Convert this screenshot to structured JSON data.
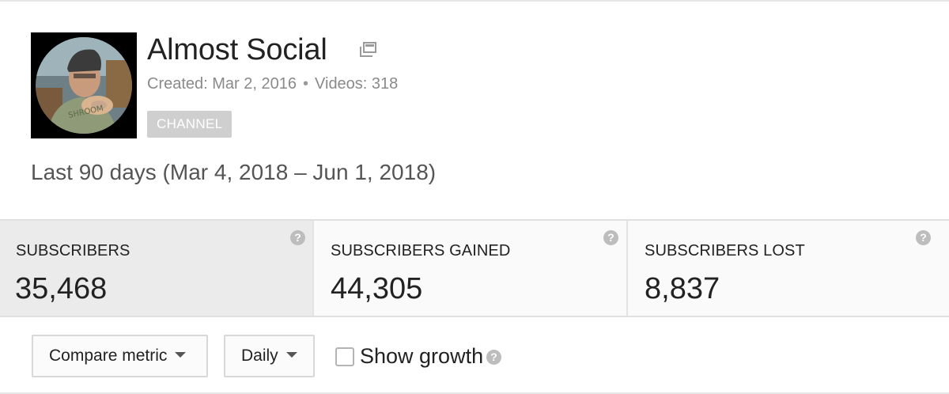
{
  "channel": {
    "name": "Almost Social",
    "created_text": "Created: Mar 2, 2016",
    "separator": "•",
    "videos_text": "Videos: 318",
    "badge": "CHANNEL",
    "avatar_icon": "channel-avatar",
    "external_icon": "external-link-icon"
  },
  "date_range": "Last 90 days (Mar 4, 2018 – Jun 1, 2018)",
  "metrics": [
    {
      "label": "SUBSCRIBERS",
      "value": "35,468",
      "selected": true
    },
    {
      "label": "SUBSCRIBERS GAINED",
      "value": "44,305",
      "selected": false
    },
    {
      "label": "SUBSCRIBERS LOST",
      "value": "8,837",
      "selected": false
    }
  ],
  "help_glyph": "?",
  "controls": {
    "compare_label": "Compare metric",
    "interval_label": "Daily",
    "show_growth_label": "Show growth",
    "show_growth_checked": false
  },
  "colors": {
    "selected_card_bg": "#ebebeb",
    "card_bg": "#fafafa",
    "badge_bg": "#cfcfcf",
    "muted_text": "#8a8a8a"
  }
}
